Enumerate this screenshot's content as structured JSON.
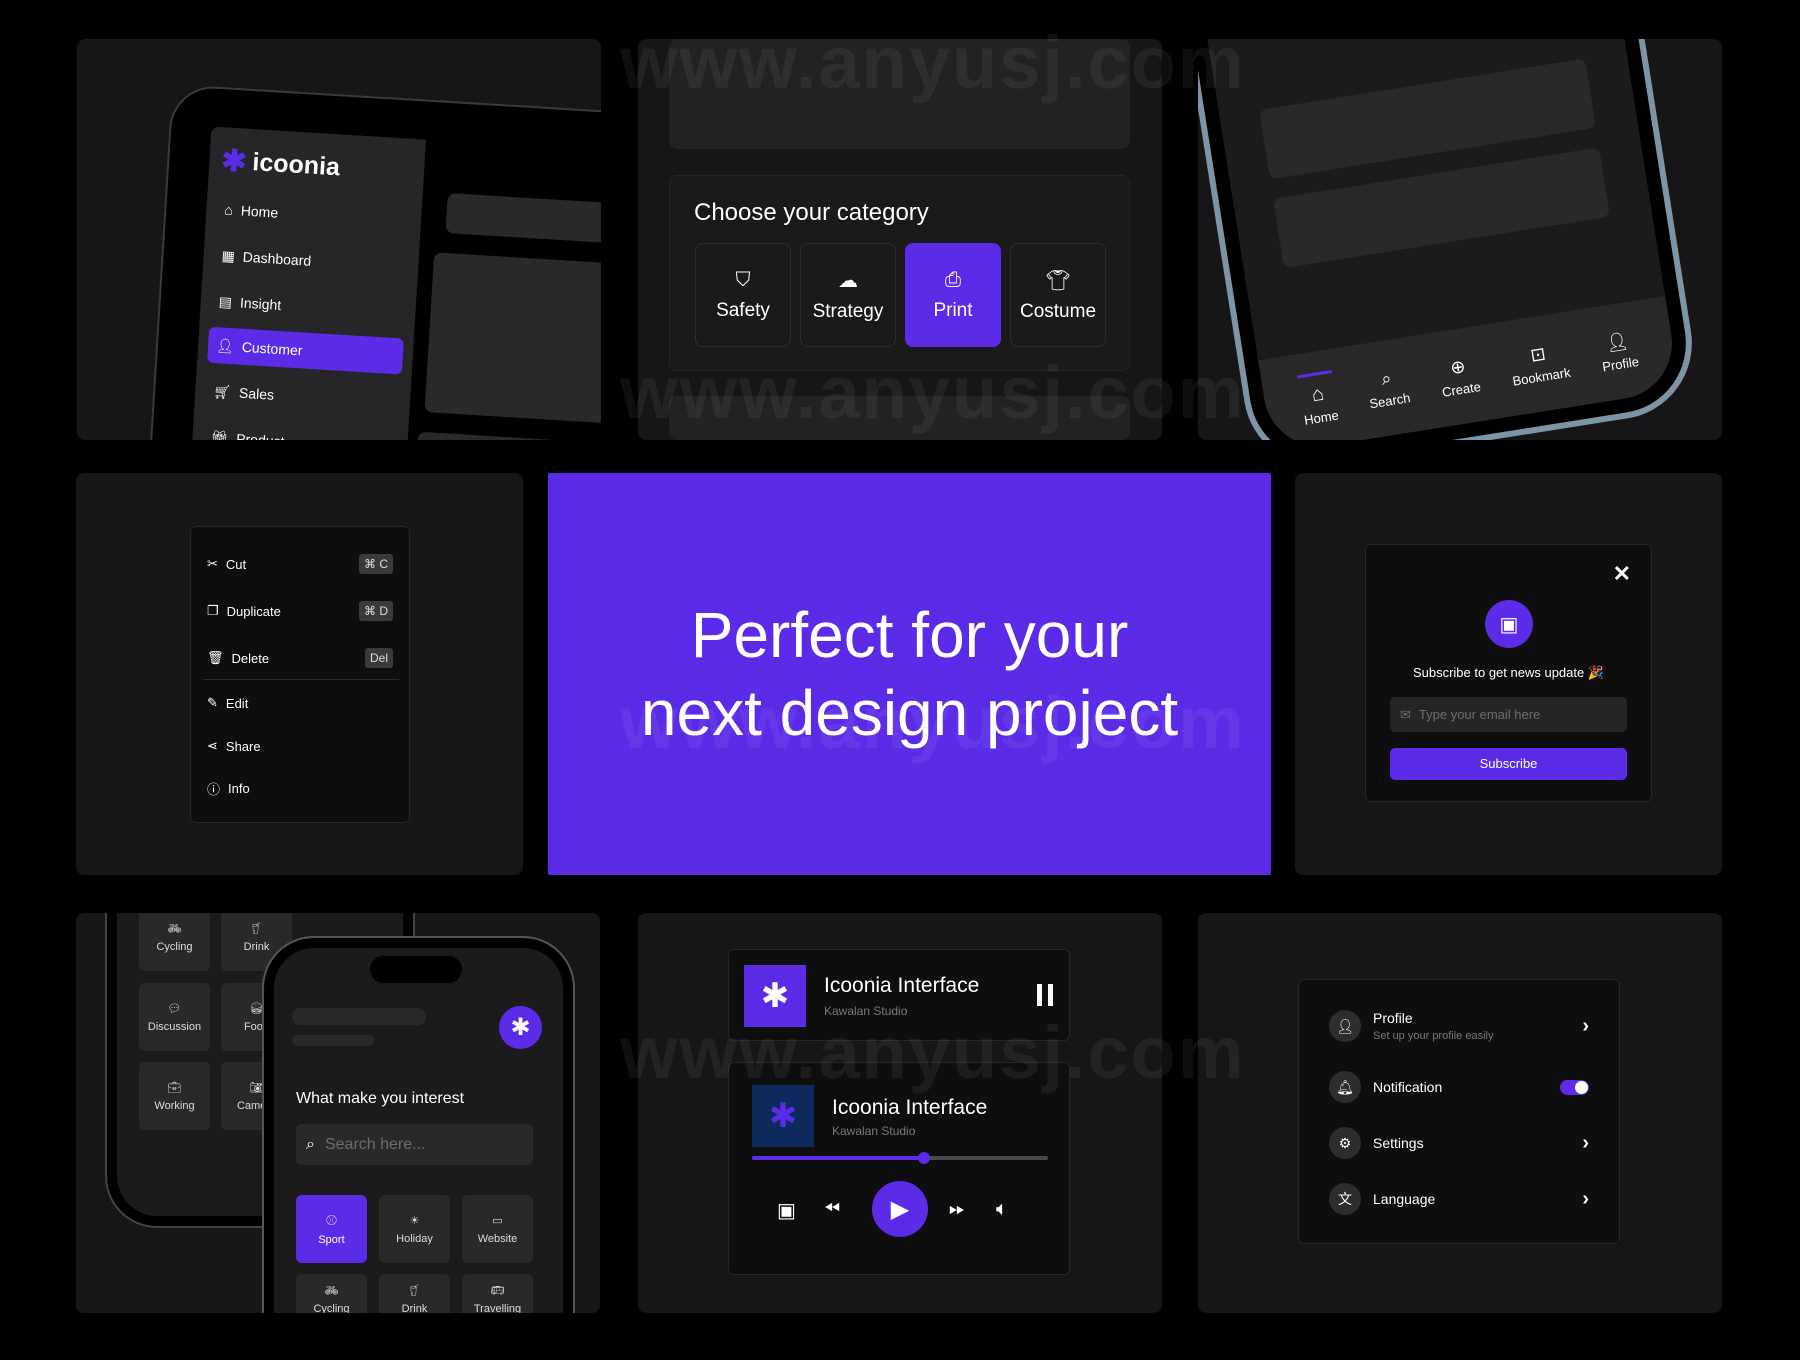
{
  "watermark": "www.anyusj.com",
  "accent": "#5b2be8",
  "sidebar": {
    "brand": "icoonia",
    "items": [
      {
        "label": "Home",
        "icon": "home-icon"
      },
      {
        "label": "Dashboard",
        "icon": "grid-icon"
      },
      {
        "label": "Insight",
        "icon": "chart-icon"
      },
      {
        "label": "Customer",
        "icon": "user-icon",
        "active": true
      },
      {
        "label": "Sales",
        "icon": "cart-icon"
      },
      {
        "label": "Product",
        "icon": "gift-icon"
      }
    ]
  },
  "category": {
    "title": "Choose your category",
    "items": [
      {
        "label": "Safety",
        "icon": "shield-icon"
      },
      {
        "label": "Strategy",
        "icon": "puzzle-icon"
      },
      {
        "label": "Print",
        "icon": "printer-icon",
        "selected": true
      },
      {
        "label": "Costume",
        "icon": "shirt-icon"
      }
    ]
  },
  "bottom_nav": {
    "items": [
      {
        "label": "Home",
        "icon": "home-icon",
        "active": true
      },
      {
        "label": "Search",
        "icon": "search-icon"
      },
      {
        "label": "Create",
        "icon": "plus-circle-icon"
      },
      {
        "label": "Bookmark",
        "icon": "bookmark-icon"
      },
      {
        "label": "Profile",
        "icon": "user-icon"
      }
    ]
  },
  "context_menu": {
    "items": [
      {
        "label": "Cut",
        "shortcut": "⌘ C",
        "icon": "scissors-icon"
      },
      {
        "label": "Duplicate",
        "shortcut": "⌘ D",
        "icon": "copy-icon"
      },
      {
        "label": "Delete",
        "shortcut": "Del",
        "icon": "trash-icon"
      },
      {
        "label": "Edit",
        "icon": "edit-icon"
      },
      {
        "label": "Share",
        "icon": "share-icon"
      },
      {
        "label": "Info",
        "icon": "info-icon"
      }
    ]
  },
  "hero": {
    "line1": "Perfect for your",
    "line2": "next design project"
  },
  "subscribe": {
    "title": "Subscribe to get news update 🎉",
    "placeholder": "Type your email here",
    "button": "Subscribe"
  },
  "interest": {
    "back_items": [
      "Cycling",
      "Drink",
      "Discussion",
      "Food",
      "Working",
      "Camera"
    ],
    "title": "What make you interest",
    "search_placeholder": "Search here...",
    "items": [
      {
        "label": "Sport",
        "icon": "ball-icon",
        "selected": true
      },
      {
        "label": "Holiday",
        "icon": "sun-icon"
      },
      {
        "label": "Website",
        "icon": "browser-icon"
      },
      {
        "label": "Cycling",
        "icon": "bike-icon"
      },
      {
        "label": "Drink",
        "icon": "cup-icon"
      },
      {
        "label": "Travelling",
        "icon": "bus-icon"
      }
    ]
  },
  "player": {
    "title": "Icoonia Interface",
    "artist": "Kawalan Studio",
    "progress": 0.58
  },
  "settings": {
    "items": [
      {
        "label": "Profile",
        "sub": "Set up your profile easily",
        "icon": "user-icon"
      },
      {
        "label": "Notification",
        "icon": "bell-icon",
        "toggle": true
      },
      {
        "label": "Settings",
        "icon": "gear-icon"
      },
      {
        "label": "Language",
        "icon": "translate-icon"
      }
    ]
  }
}
